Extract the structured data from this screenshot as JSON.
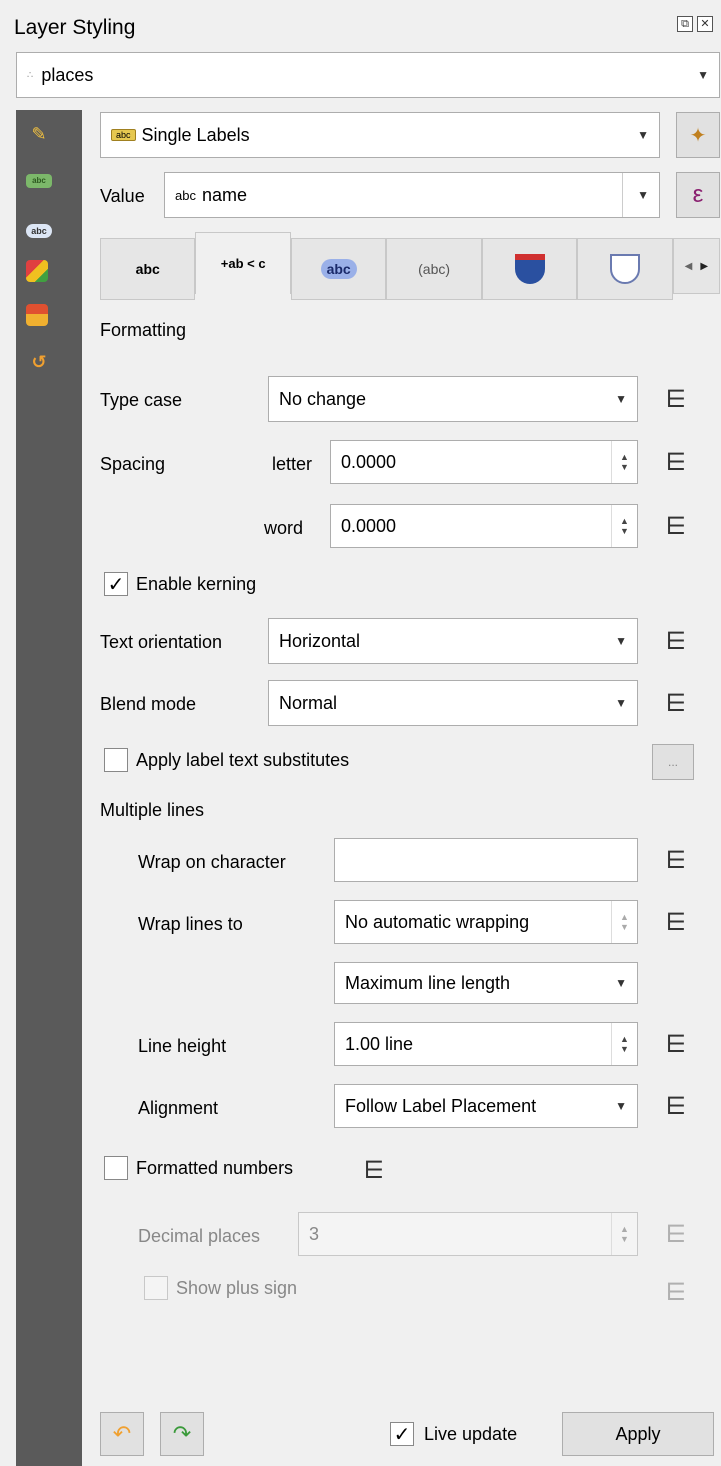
{
  "panel": {
    "title": "Layer Styling",
    "float_glyph": "⧉",
    "close_glyph": "✕"
  },
  "layer": {
    "name": "places"
  },
  "renderer": {
    "badge": "abc",
    "mode": "Single Labels"
  },
  "value": {
    "label": "Value",
    "prefix": "abc",
    "field": "name",
    "expr_glyph": "ε"
  },
  "tabs": [
    {
      "label": "abc",
      "icon": "text-tab-icon"
    },
    {
      "label": "+ab < c",
      "icon": "formatting-tab-icon"
    },
    {
      "label": "abc",
      "icon": "buffer-tab-icon"
    },
    {
      "label": "(abc)",
      "icon": "mask-tab-icon"
    },
    {
      "label": "",
      "icon": "background-tab-icon"
    },
    {
      "label": "",
      "icon": "shadow-tab-icon"
    }
  ],
  "sidebar_icons": [
    "paintbrush-icon",
    "labels-icon",
    "masks-icon",
    "3d-view-icon",
    "diagrams-icon",
    "history-icon"
  ],
  "formatting": {
    "section": "Formatting",
    "type_case": {
      "label": "Type case",
      "value": "No change"
    },
    "spacing": {
      "label": "Spacing",
      "letter_label": "letter",
      "letter_value": "0.0000",
      "word_label": "word",
      "word_value": "0.0000"
    },
    "kerning": {
      "label": "Enable kerning",
      "checked": true,
      "mark": "✓"
    },
    "orientation": {
      "label": "Text orientation",
      "value": "Horizontal"
    },
    "blend": {
      "label": "Blend mode",
      "value": "Normal"
    },
    "substitutes": {
      "label": "Apply label text substitutes",
      "checked": false,
      "button": "..."
    }
  },
  "multiple_lines": {
    "section": "Multiple lines",
    "wrap_char": {
      "label": "Wrap on character",
      "value": ""
    },
    "wrap_lines": {
      "label": "Wrap lines to",
      "value": "No automatic wrapping"
    },
    "length_mode": {
      "value": "Maximum line length"
    },
    "line_height": {
      "label": "Line height",
      "value": "1.00 line"
    },
    "alignment": {
      "label": "Alignment",
      "value": "Follow Label Placement"
    }
  },
  "numbers": {
    "formatted": {
      "label": "Formatted numbers",
      "checked": false
    },
    "decimal": {
      "label": "Decimal places",
      "value": "3"
    },
    "plus_sign": {
      "label": "Show plus sign",
      "checked": false
    }
  },
  "footer": {
    "live_update": "Live update",
    "live_checked": true,
    "live_mark": "✓",
    "apply": "Apply"
  },
  "colors": {
    "sidebar_bg": "#5a5a5a",
    "undo": "#f0a030",
    "redo": "#3a9a3a"
  }
}
